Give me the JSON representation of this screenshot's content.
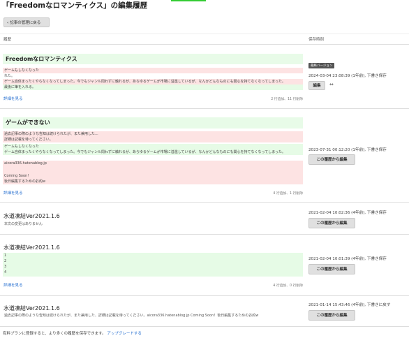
{
  "page": {
    "title": "「Freedomなロマンティクス」の編集履歴",
    "back_label": "記事の管理に戻る"
  },
  "table_header": {
    "history": "履歴",
    "saved_at": "保存時刻"
  },
  "entries": [
    {
      "title": "Freedomなロマンティクス",
      "lines": [
        {
          "type": "del",
          "text": "ゲームもしなくなった"
        },
        {
          "type": "plain",
          "text": "れた。"
        },
        {
          "type": "del",
          "text": "ゲーム自体まったくやらなくなってしまった。今でもジャンル問わずに触れるが、あらゆるゲームが市場に溢濫しているが、なんかどんなものにも関心を持てなくなってしまった。"
        },
        {
          "type": "add",
          "text": "最後に筆を入れる。"
        }
      ],
      "detail": "詳細を見る",
      "stats": "2 行追加、11 行削除",
      "badge": "最終バージョン",
      "time": "2024-03-04 23:08:39 (1年前), 下書き保存",
      "button": "編集",
      "arrow": "⇔"
    },
    {
      "title": "ゲームができない",
      "lines": [
        {
          "type": "del",
          "text": "過去記事の際のような告知は続けられたが、また兼用した..."
        },
        {
          "type": "del",
          "text": "詳細は記載を待ってください。"
        },
        {
          "type": "add",
          "text": "ゲームもしなくなった"
        },
        {
          "type": "add",
          "text": "ゲーム自体まったくやらなくなってしまった。今でもジャンル問わずに触れるが、あらゆるゲームが市場に溢濫しているが、なんかどんなものにも関心を持てなくなってしまった。"
        },
        {
          "type": "del",
          "text": "aicora336.hatenablog.jp"
        },
        {
          "type": "del",
          "text": ""
        },
        {
          "type": "del",
          "text": "Coming Soon！"
        },
        {
          "type": "del",
          "text": "後日編集するためのお約w"
        }
      ],
      "detail": "詳細を見る",
      "stats": "4 行追加、1 行削除",
      "time": "2023-07-31 00:12:20 (1年前), 下書き保存",
      "button": "この履歴から編集"
    },
    {
      "title": "水道凍結Ver2021.1.6",
      "lines": [
        {
          "type": "plain",
          "text": "本文の変更はありません"
        }
      ],
      "time": "2021-02-04 10:02:36 (4年前), 下書き保存",
      "button": "この履歴から編集"
    },
    {
      "title": "水道凍結Ver2021.1.6",
      "lines": [
        {
          "type": "add",
          "text": "1"
        },
        {
          "type": "add",
          "text": "2"
        },
        {
          "type": "add",
          "text": "3"
        },
        {
          "type": "add",
          "text": "4"
        }
      ],
      "detail": "詳細を見る",
      "stats": "4 行追加、0 行削除",
      "time": "2021-02-04 10:01:39 (4年前), 下書き保存",
      "button": "この履歴から編集"
    },
    {
      "title": "水道凍結Ver2021.1.6",
      "lines": [
        {
          "type": "plain",
          "text": "過去記事の際のような告知は続けられたが、また兼用した、詳細は記載を待ってください。aicora336.hatenablog.jp Coming Soon！後日編集するためのお約w"
        }
      ],
      "time": "2021-01-14 15:43:46 (4年前), 下書きに戻す",
      "button": "この履歴から編集"
    }
  ],
  "footer": {
    "text": "有料プランに登録すると、より多くの履歴を保存できます。",
    "link": "アップグレードする"
  },
  "colors": {
    "deleted_bg": "#fde3e3",
    "added_bg": "#e6fbe6",
    "link": "#2870d0"
  }
}
